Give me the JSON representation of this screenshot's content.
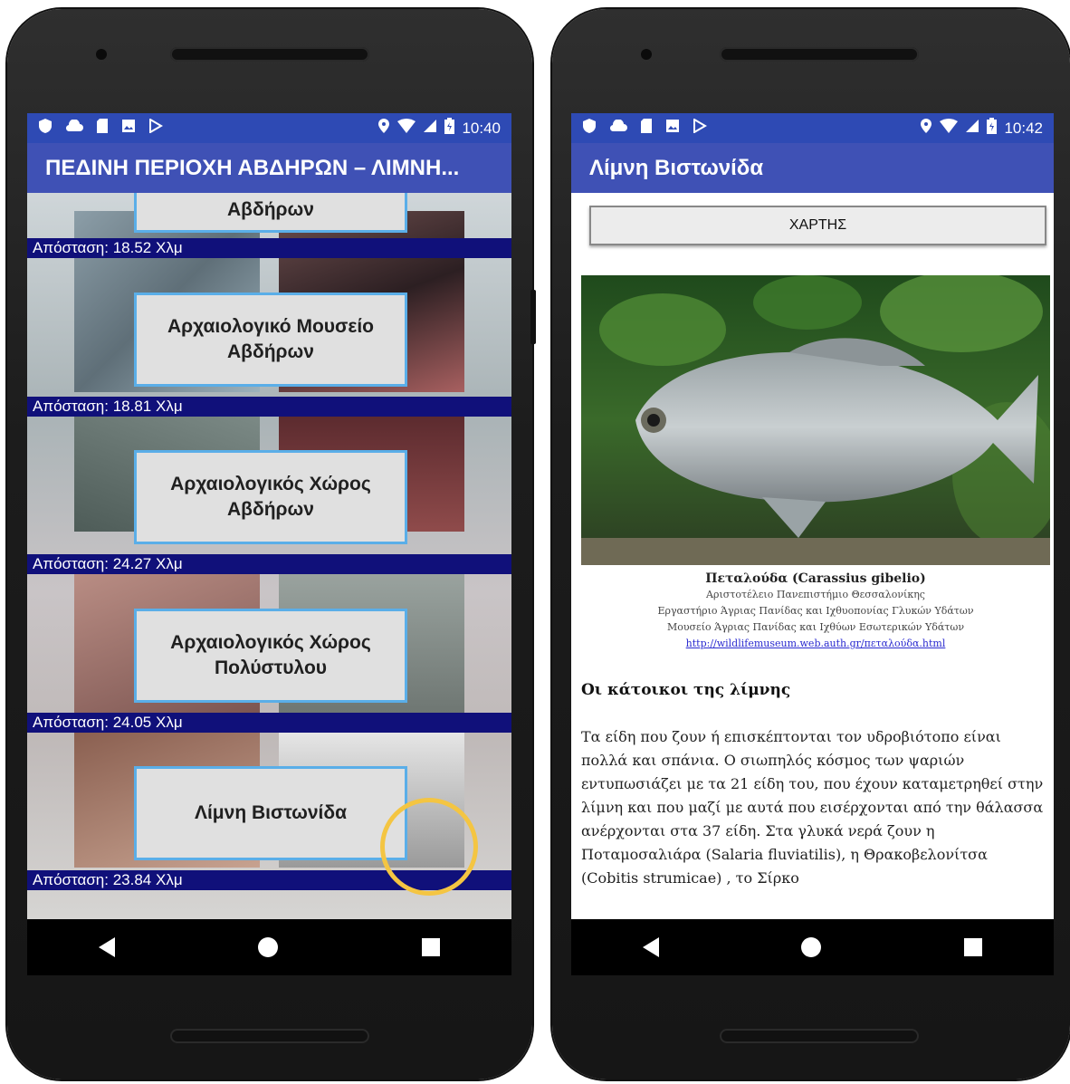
{
  "left": {
    "status": {
      "time": "10:40"
    },
    "title": "ΠΕΔΙΝΗ ΠΕΡΙΟΧΗ ΑΒΔΗΡΩΝ – ΛΙΜΝΗ...",
    "partial_item": {
      "label": "Αβδήρων",
      "distance": "Απόσταση: 18.52 Χλμ"
    },
    "items": [
      {
        "label": "Αρχαιολογικό Μουσείο Αβδήρων",
        "distance": "Απόσταση: 18.81 Χλμ"
      },
      {
        "label": "Αρχαιολογικός Χώρος Αβδήρων",
        "distance": "Απόσταση: 24.27 Χλμ"
      },
      {
        "label": "Αρχαιολογικός Χώρος Πολύστυλου",
        "distance": "Απόσταση: 24.05 Χλμ"
      },
      {
        "label": "Λίμνη Βιστωνίδα",
        "distance": "Απόσταση: 23.84 Χλμ"
      }
    ]
  },
  "right": {
    "status": {
      "time": "10:42"
    },
    "title": "Λίμνη Βιστωνίδα",
    "map_button": "ΧΑΡΤΗΣ",
    "caption": {
      "title": "Πεταλούδα (Carassius gibelio)",
      "lines": [
        "Αριστοτέλειο Πανεπιστήμιο Θεσσαλονίκης",
        "Εργαστήριο Άγριας Πανίδας και Ιχθυοπονίας Γλυκών Υδάτων",
        "Μουσείο Άγριας Πανίδας και Ιχθύων Εσωτερικών Υδάτων"
      ],
      "link": "http://wildlifemuseum.web.auth.gr/πεταλούδα.html"
    },
    "section_title": "Οι κάτοικοι της λίμνης",
    "paragraph": "Τα είδη που ζουν ή επισκέπτονται τον υδροβιότοπο είναι πολλά και σπάνια. Ο σιωπηλός κόσμος των ψαριών εντυπωσιάζει με τα 21 είδη του, που έχουν καταμετρηθεί στην λίμνη και που μαζί με αυτά που εισέρχονται από την θάλασσα ανέρχονται στα 37 είδη.  Στα γλυκά νερά ζουν η Ποταμοσαλιάρα (Salaria fluviatilis), η Θρακοβελονίτσα (Cobitis strumicae) , το Σίρκο"
  },
  "colors": {
    "status_bar": "#2e4ab4",
    "app_bar": "#3f51b5",
    "distance_bar": "#10107a",
    "button_border": "#5aaee8",
    "highlight": "#f4c542"
  },
  "icons": [
    "shield-icon",
    "cloud-icon",
    "sd-card-icon",
    "photo-icon",
    "play-store-icon",
    "location-icon",
    "wifi-icon",
    "signal-icon",
    "battery-icon",
    "back-icon",
    "home-icon",
    "recents-icon"
  ]
}
